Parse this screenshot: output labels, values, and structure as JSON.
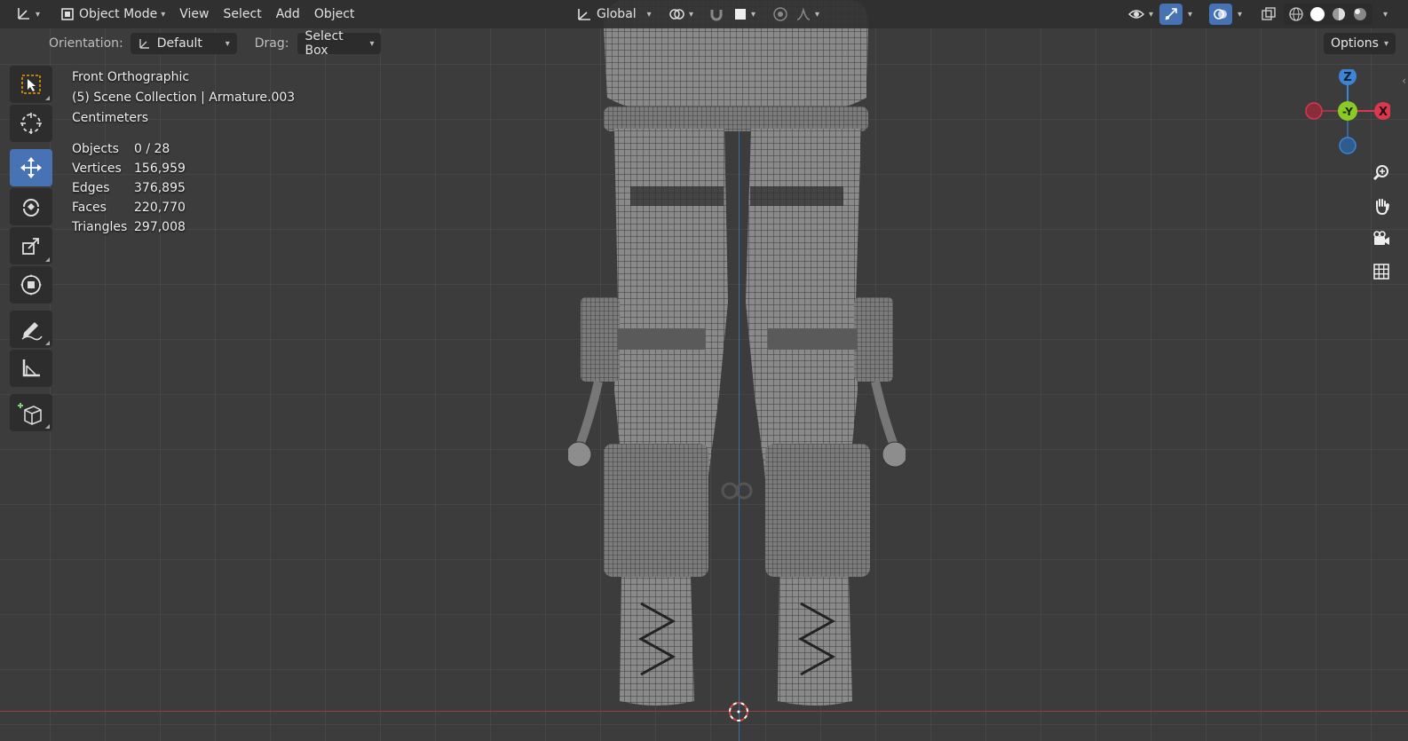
{
  "header": {
    "editor_type_icon": "axes-icon",
    "mode": "Object Mode",
    "menus": [
      "View",
      "Select",
      "Add",
      "Object"
    ],
    "transform_orientation": "Global"
  },
  "subheader": {
    "orientation_label": "Orientation:",
    "orientation_value": "Default",
    "drag_label": "Drag:",
    "drag_value": "Select Box",
    "options_label": "Options"
  },
  "viewport_info": {
    "view_name": "Front Orthographic",
    "collection": "(5) Scene Collection | Armature.003",
    "units": "Centimeters"
  },
  "stats": [
    {
      "label": "Objects",
      "value": "0 / 28"
    },
    {
      "label": "Vertices",
      "value": "156,959"
    },
    {
      "label": "Edges",
      "value": "376,895"
    },
    {
      "label": "Faces",
      "value": "220,770"
    },
    {
      "label": "Triangles",
      "value": "297,008"
    }
  ],
  "toolbar": {
    "tools": [
      "select-box-icon",
      "cursor-icon",
      "move-icon",
      "rotate-icon",
      "scale-icon",
      "transform-icon",
      "annotate-icon",
      "measure-icon",
      "add-cube-icon"
    ],
    "active_tool": "move-icon"
  },
  "gizmo": {
    "z_label": "Z",
    "y_label": "-Y",
    "x_label": "X"
  },
  "colors": {
    "accent": "#4772b3",
    "x_axis": "#d9384f",
    "y_axis": "#8ac926",
    "z_axis": "#3b84d6"
  }
}
